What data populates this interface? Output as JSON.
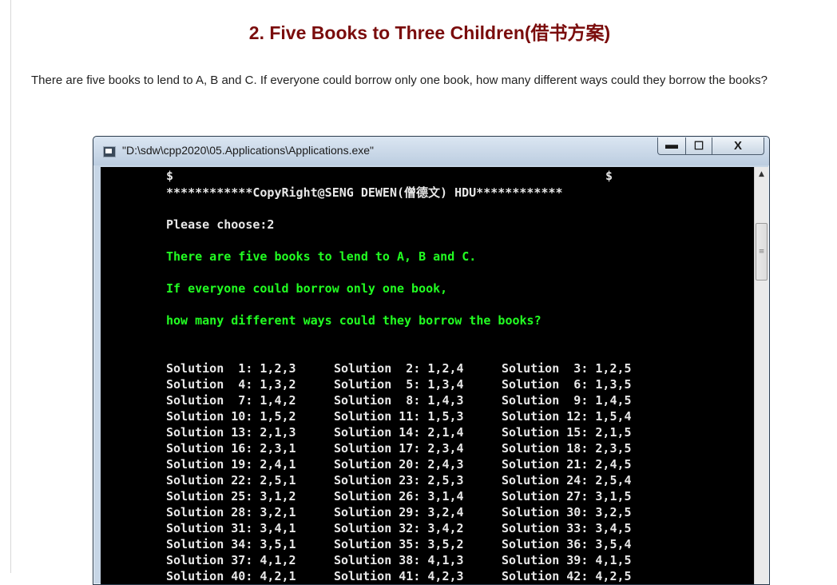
{
  "page": {
    "title": "2. Five Books to Three Children(借书方案)",
    "description": "There are five books to lend to A, B and C. If everyone could borrow only one book, how many different ways could they borrow the books?"
  },
  "window": {
    "title": "\"D:\\sdw\\cpp2020\\05.Applications\\Applications.exe\"",
    "minimize": "▬",
    "maximize": "☐",
    "close": "X"
  },
  "console": {
    "header_left": "$",
    "header_right": "$",
    "banner": "************CopyRight@SENG DEWEN(僧德文) HDU************",
    "prompt": "Please choose:2",
    "question1": "There are five books to lend to A, B and C.",
    "question2": "If everyone could borrow only one book,",
    "question3": "how many different ways could they borrow the books?",
    "solutions": [
      [
        "Solution  1: 1,2,3",
        "Solution  2: 1,2,4",
        "Solution  3: 1,2,5"
      ],
      [
        "Solution  4: 1,3,2",
        "Solution  5: 1,3,4",
        "Solution  6: 1,3,5"
      ],
      [
        "Solution  7: 1,4,2",
        "Solution  8: 1,4,3",
        "Solution  9: 1,4,5"
      ],
      [
        "Solution 10: 1,5,2",
        "Solution 11: 1,5,3",
        "Solution 12: 1,5,4"
      ],
      [
        "Solution 13: 2,1,3",
        "Solution 14: 2,1,4",
        "Solution 15: 2,1,5"
      ],
      [
        "Solution 16: 2,3,1",
        "Solution 17: 2,3,4",
        "Solution 18: 2,3,5"
      ],
      [
        "Solution 19: 2,4,1",
        "Solution 20: 2,4,3",
        "Solution 21: 2,4,5"
      ],
      [
        "Solution 22: 2,5,1",
        "Solution 23: 2,5,3",
        "Solution 24: 2,5,4"
      ],
      [
        "Solution 25: 3,1,2",
        "Solution 26: 3,1,4",
        "Solution 27: 3,1,5"
      ],
      [
        "Solution 28: 3,2,1",
        "Solution 29: 3,2,4",
        "Solution 30: 3,2,5"
      ],
      [
        "Solution 31: 3,4,1",
        "Solution 32: 3,4,2",
        "Solution 33: 3,4,5"
      ],
      [
        "Solution 34: 3,5,1",
        "Solution 35: 3,5,2",
        "Solution 36: 3,5,4"
      ],
      [
        "Solution 37: 4,1,2",
        "Solution 38: 4,1,3",
        "Solution 39: 4,1,5"
      ],
      [
        "Solution 40: 4,2,1",
        "Solution 41: 4,2,3",
        "Solution 42: 4,2,5"
      ]
    ]
  },
  "colors": {
    "title": "#7a0c0c",
    "console_bg": "#000000",
    "console_text": "#e8e8e8",
    "console_green": "#22ff22"
  }
}
